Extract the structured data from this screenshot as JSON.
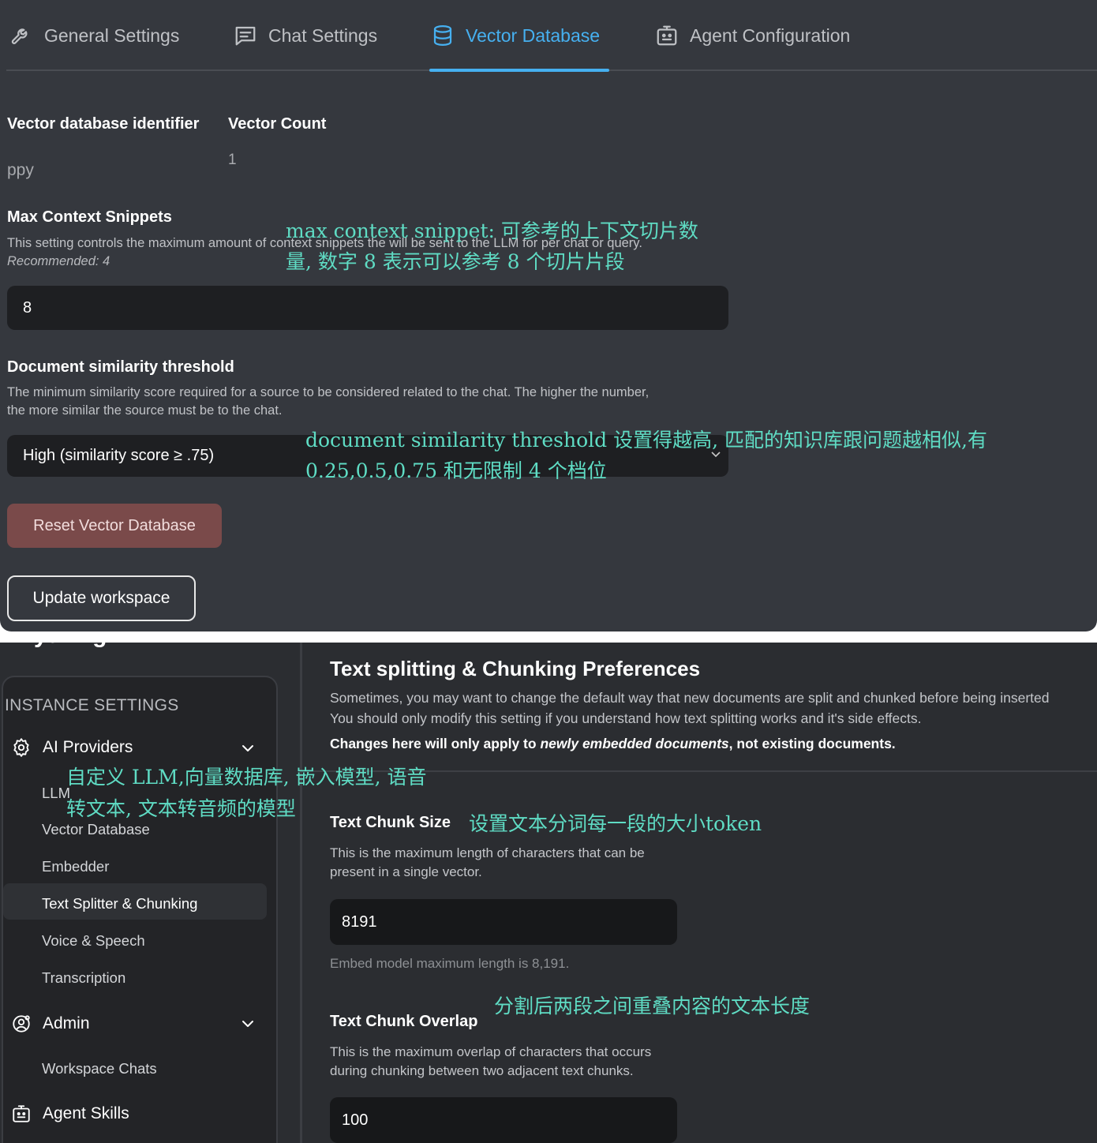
{
  "tabs": [
    {
      "label": "General Settings",
      "icon": "wrench-icon"
    },
    {
      "label": "Chat Settings",
      "icon": "chat-icon"
    },
    {
      "label": "Vector Database",
      "icon": "database-icon"
    },
    {
      "label": "Agent Configuration",
      "icon": "robot-icon"
    }
  ],
  "active_tab": "Vector Database",
  "vector_db": {
    "identifier_label": "Vector database identifier",
    "identifier_value": "ppy",
    "count_label": "Vector Count",
    "count_value": "1"
  },
  "max_snippets": {
    "label": "Max Context Snippets",
    "description": "This setting controls the maximum amount of context snippets the will be sent to the LLM for per chat or query.",
    "recommended": "Recommended: 4",
    "value": "8"
  },
  "similarity": {
    "label": "Document similarity threshold",
    "description_line1": "The minimum similarity score required for a source to be considered related to the chat. The higher the number,",
    "description_line2": "the more similar the source must be to the chat.",
    "selected": "High (similarity score ≥ .75)"
  },
  "buttons": {
    "reset": "Reset Vector Database",
    "update": "Update workspace"
  },
  "annotations": {
    "snippet_line1": "max context snippet: 可参考的上下文切片数",
    "snippet_line2": "量, 数字 8 表示可以参考 8 个切片片段",
    "similarity_line1": "document similarity threshold 设置得越高, 匹配的知识库跟问题越相似,有",
    "similarity_line2": "0.25,0.5,0.75 和无限制 4 个档位",
    "providers_line1": "自定义 LLM,向量数据库, 嵌入模型, 语音",
    "providers_line2": "转文本, 文本转音频的模型",
    "chunk_size": "设置文本分词每一段的大小token",
    "chunk_overlap": "分割后两段之间重叠内容的文本长度"
  },
  "brand": "AnythingLLM",
  "sidebar": {
    "heading": "INSTANCE SETTINGS",
    "groups": [
      {
        "label": "AI Providers",
        "icon": "gear-icon",
        "items": [
          "LLM",
          "Vector Database",
          "Embedder",
          "Text Splitter & Chunking",
          "Voice & Speech",
          "Transcription"
        ]
      },
      {
        "label": "Admin",
        "icon": "user-gear-icon",
        "items": [
          "Workspace Chats"
        ]
      },
      {
        "label": "Agent Skills",
        "icon": "robot-icon",
        "items": []
      }
    ],
    "active_item": "Text Splitter & Chunking"
  },
  "chunking": {
    "title": "Text splitting & Chunking Preferences",
    "desc_line1": "Sometimes, you may want to change the default way that new documents are split and chunked before being inserted",
    "desc_line2": "You should only modify this setting if you understand how text splitting works and it's side effects.",
    "note_prefix": "Changes here will only apply to ",
    "note_emph": "newly embedded documents",
    "note_suffix": ", not existing documents.",
    "size_label": "Text Chunk Size",
    "size_desc": "This is the maximum length of characters that can be present in a single vector.",
    "size_value": "8191",
    "size_hint": "Embed model maximum length is 8,191.",
    "overlap_label": "Text Chunk Overlap",
    "overlap_desc": "This is the maximum overlap of characters that occurs during chunking between two adjacent text chunks.",
    "overlap_value": "100"
  },
  "colors": {
    "accent": "#46b0f0",
    "annotation": "#5fdcc4",
    "danger": "#7a4a4a"
  }
}
